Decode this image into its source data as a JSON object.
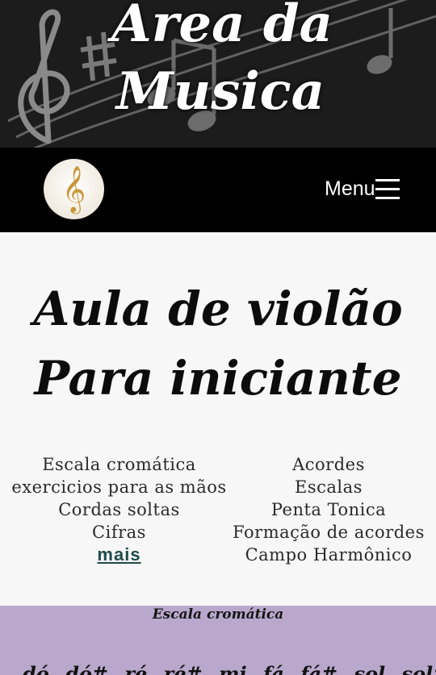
{
  "banner": {
    "title_line1": "Área da",
    "title_line2": "Musica"
  },
  "navbar": {
    "logo_glyph": "𝄞",
    "menu_label": "Menu"
  },
  "heading": {
    "line1": "Aula de violão",
    "line2": "Para iniciante"
  },
  "links_left": [
    "Escala cromática",
    "exercicios para as mãos",
    "Cordas soltas",
    "Cifras"
  ],
  "more_link": "mais",
  "links_right": [
    "Acordes",
    "Escalas",
    "Penta Tonica",
    "Formação de acordes",
    "Campo Harmônico"
  ],
  "section": {
    "title": "Escala cromática",
    "notes": "dó dó# ré ré# mi fá fá# sol sol# lá"
  },
  "colors": {
    "banner_bg": "#1c1c1c",
    "navbar_bg": "#000000",
    "page_bg": "#f7f7f7",
    "section_bg": "#b9a8cc",
    "more_link": "#1f4b4b",
    "logo_clef": "#c9973a"
  }
}
